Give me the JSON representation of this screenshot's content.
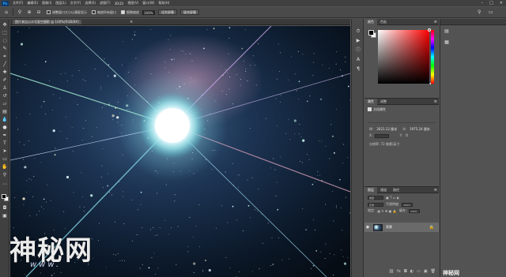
{
  "app": {
    "logo": "Ps"
  },
  "menubar": {
    "items": [
      "文件(F)",
      "编辑(E)",
      "图像(I)",
      "图层(L)",
      "文字(Y)",
      "选择(S)",
      "滤镜(T)",
      "3D(D)",
      "视图(V)",
      "窗口(W)",
      "帮助(H)"
    ],
    "window_controls": {
      "minimize": "–",
      "maximize": "□",
      "close": "✕"
    }
  },
  "options_bar": {
    "tool_icon": "zoom-icon",
    "resize_windows_label": "调整窗口大小以满屏显示",
    "zoom_all_windows_label": "缩放所有窗口",
    "scrubby_zoom_label": "细微缩放",
    "zoom_value": "100%",
    "fit_screen_label": "适合屏幕",
    "fill_screen_label": "填充屏幕"
  },
  "document": {
    "tab_label": "图片来自公众号星空摄影 @ 100%(RGB/8#)",
    "close": "×"
  },
  "color_panel": {
    "tabs": [
      "颜色",
      "色板"
    ],
    "fg_color": "#000000",
    "bg_color": "#ffffff",
    "hue_color": "#ff0000"
  },
  "properties_panel": {
    "tabs": [
      "属性",
      "调整"
    ],
    "title": "文档属性",
    "w_label": "W:",
    "w_value": "2621.12 厘米",
    "h_label": "H:",
    "h_value": "1975.24 厘米",
    "x_label": "X:",
    "x_value": "0",
    "y_label": "Y:",
    "y_value": "0",
    "resolution": "分辨率: 72 像素/英寸"
  },
  "layers_panel": {
    "tabs": [
      "图层",
      "通道",
      "路径"
    ],
    "kind_label": "类型",
    "blend_mode": "正常",
    "opacity_label": "不透明度:",
    "opacity_value": "100%",
    "lock_label": "锁定:",
    "fill_label": "填充:",
    "fill_value": "100%",
    "layers": [
      {
        "name": "背景",
        "visible": true,
        "locked": true
      }
    ]
  },
  "watermark": {
    "main": "神秘网",
    "sub": "www.",
    "small": "神秘网"
  }
}
